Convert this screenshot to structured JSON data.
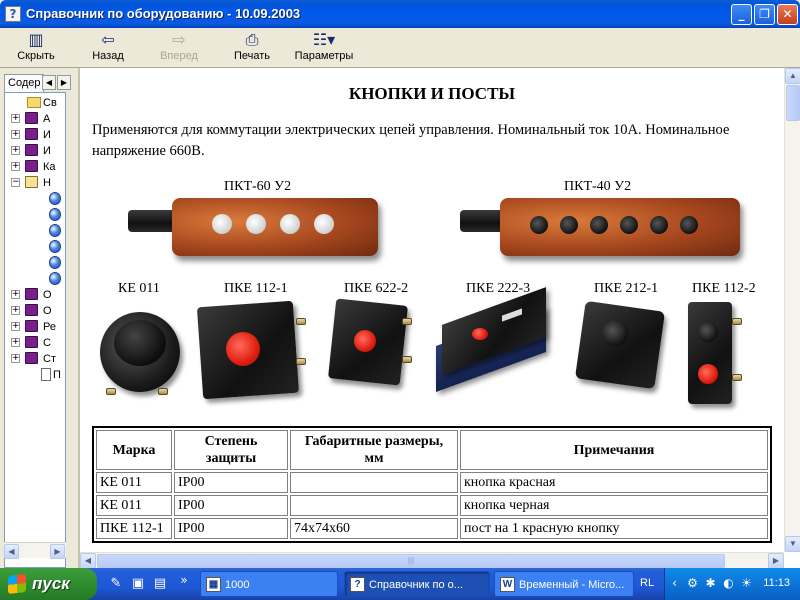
{
  "window": {
    "title": "Справочник по оборудованию - 10.09.2003",
    "minimize": "_",
    "maximize": "❐",
    "close": "✕"
  },
  "toolbar": {
    "hide_label": "Скрыть",
    "back_label": "Назад",
    "forward_label": "Вперед",
    "print_label": "Печать",
    "options_label": "Параметры"
  },
  "left_pane": {
    "tab_label": "Содер",
    "items": [
      {
        "icon": "folder-icon",
        "label": "Св"
      },
      {
        "icon": "book-icon",
        "label": "А"
      },
      {
        "icon": "book-icon",
        "label": "И"
      },
      {
        "icon": "book-icon",
        "label": "И"
      },
      {
        "icon": "book-icon",
        "label": "Ка"
      },
      {
        "icon": "open-book-icon",
        "label": "Н"
      },
      {
        "icon": "page-icon",
        "label": ""
      },
      {
        "icon": "page-icon",
        "label": ""
      },
      {
        "icon": "page-icon",
        "label": ""
      },
      {
        "icon": "page-icon",
        "label": ""
      },
      {
        "icon": "page-icon",
        "label": ""
      },
      {
        "icon": "page-icon",
        "label": ""
      },
      {
        "icon": "book-icon",
        "label": "О"
      },
      {
        "icon": "book-icon",
        "label": "О"
      },
      {
        "icon": "book-icon",
        "label": "Ре"
      },
      {
        "icon": "book-icon",
        "label": "С"
      },
      {
        "icon": "book-icon",
        "label": "Ст"
      },
      {
        "icon": "document-icon",
        "label": "П"
      }
    ]
  },
  "content": {
    "heading": "КНОПКИ И ПОСТЫ",
    "description": "Применяются для коммутации электрических цепей управления. Номинальный ток 10А. Номинальное напряжение 660В.",
    "stations": [
      {
        "label": "ПКТ-60 У2"
      },
      {
        "label": "ПКТ-40 У2"
      }
    ],
    "buttons": [
      {
        "label": "КЕ 011"
      },
      {
        "label": "ПКЕ 112-1"
      },
      {
        "label": "ПКЕ 622-2"
      },
      {
        "label": "ПКЕ 222-3"
      },
      {
        "label": "ПКЕ 212-1"
      },
      {
        "label": "ПКЕ 112-2"
      }
    ],
    "table": {
      "headers": [
        "Марка",
        "Степень защиты",
        "Габаритные размеры, мм",
        "Примечания"
      ],
      "rows": [
        [
          "КЕ 011",
          "IP00",
          "",
          "кнопка красная"
        ],
        [
          "КЕ 011",
          "IP00",
          "",
          "кнопка черная"
        ],
        [
          "ПКЕ 112-1",
          "IP00",
          "74х74х60",
          "пост на 1 красную кнопку"
        ]
      ]
    }
  },
  "taskbar": {
    "start_label": "пуск",
    "tasks": [
      {
        "label": "1000"
      },
      {
        "label": "Справочник по о..."
      },
      {
        "label": "Временный - Micro..."
      }
    ],
    "language": "RL",
    "clock": "11:13"
  }
}
